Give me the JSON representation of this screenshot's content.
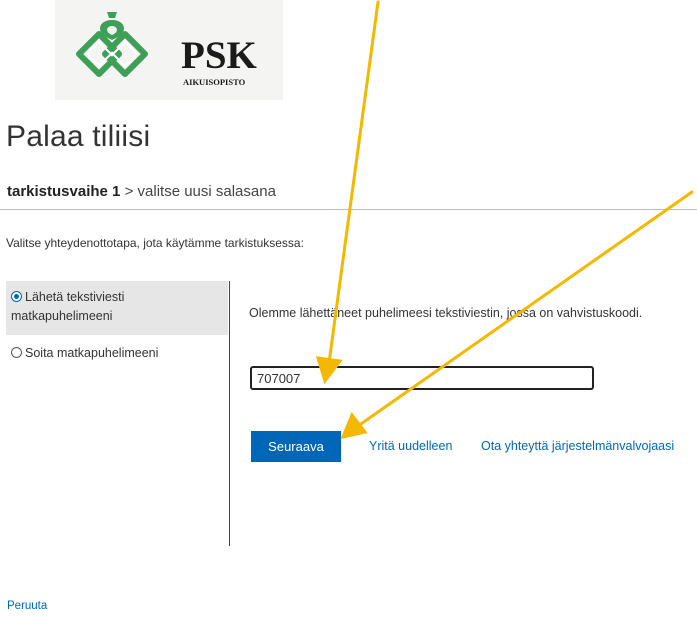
{
  "logo": {
    "name": "PSK",
    "subtitle": "AIKUISOPISTO",
    "icon": "psk-leaf-emblem",
    "colors": {
      "emblem": "#3f9f57",
      "text": "#1b1b1b"
    }
  },
  "page": {
    "title": "Palaa tiliisi",
    "step_current": "tarkistusvaihe 1",
    "step_separator": ">",
    "step_next": "valitse uusi salasana"
  },
  "instruction": "Valitse yhteydenottotapa, jota käytämme tarkistuksessa:",
  "options": [
    {
      "label_line1": "Lähetä tekstiviesti",
      "label_line2": "matkapuhelimeeni",
      "selected": true
    },
    {
      "label_line1": "Soita matkapuhelimeeni",
      "selected": false
    }
  ],
  "verification": {
    "message": "Olemme lähettäneet puhelimeesi tekstiviestin, jossa on vahvistuskoodi.",
    "code_value": "707007"
  },
  "actions": {
    "next_label": "Seuraava",
    "retry_label": "Yritä uudelleen",
    "contact_admin_label": "Ota yhteyttä järjestelmänvalvojaasi",
    "cancel_label": "Peruuta"
  },
  "colors": {
    "accent": "#0067b8",
    "annotation_arrow": "#f5b800",
    "selected_option_bg": "#e6e6e6"
  }
}
